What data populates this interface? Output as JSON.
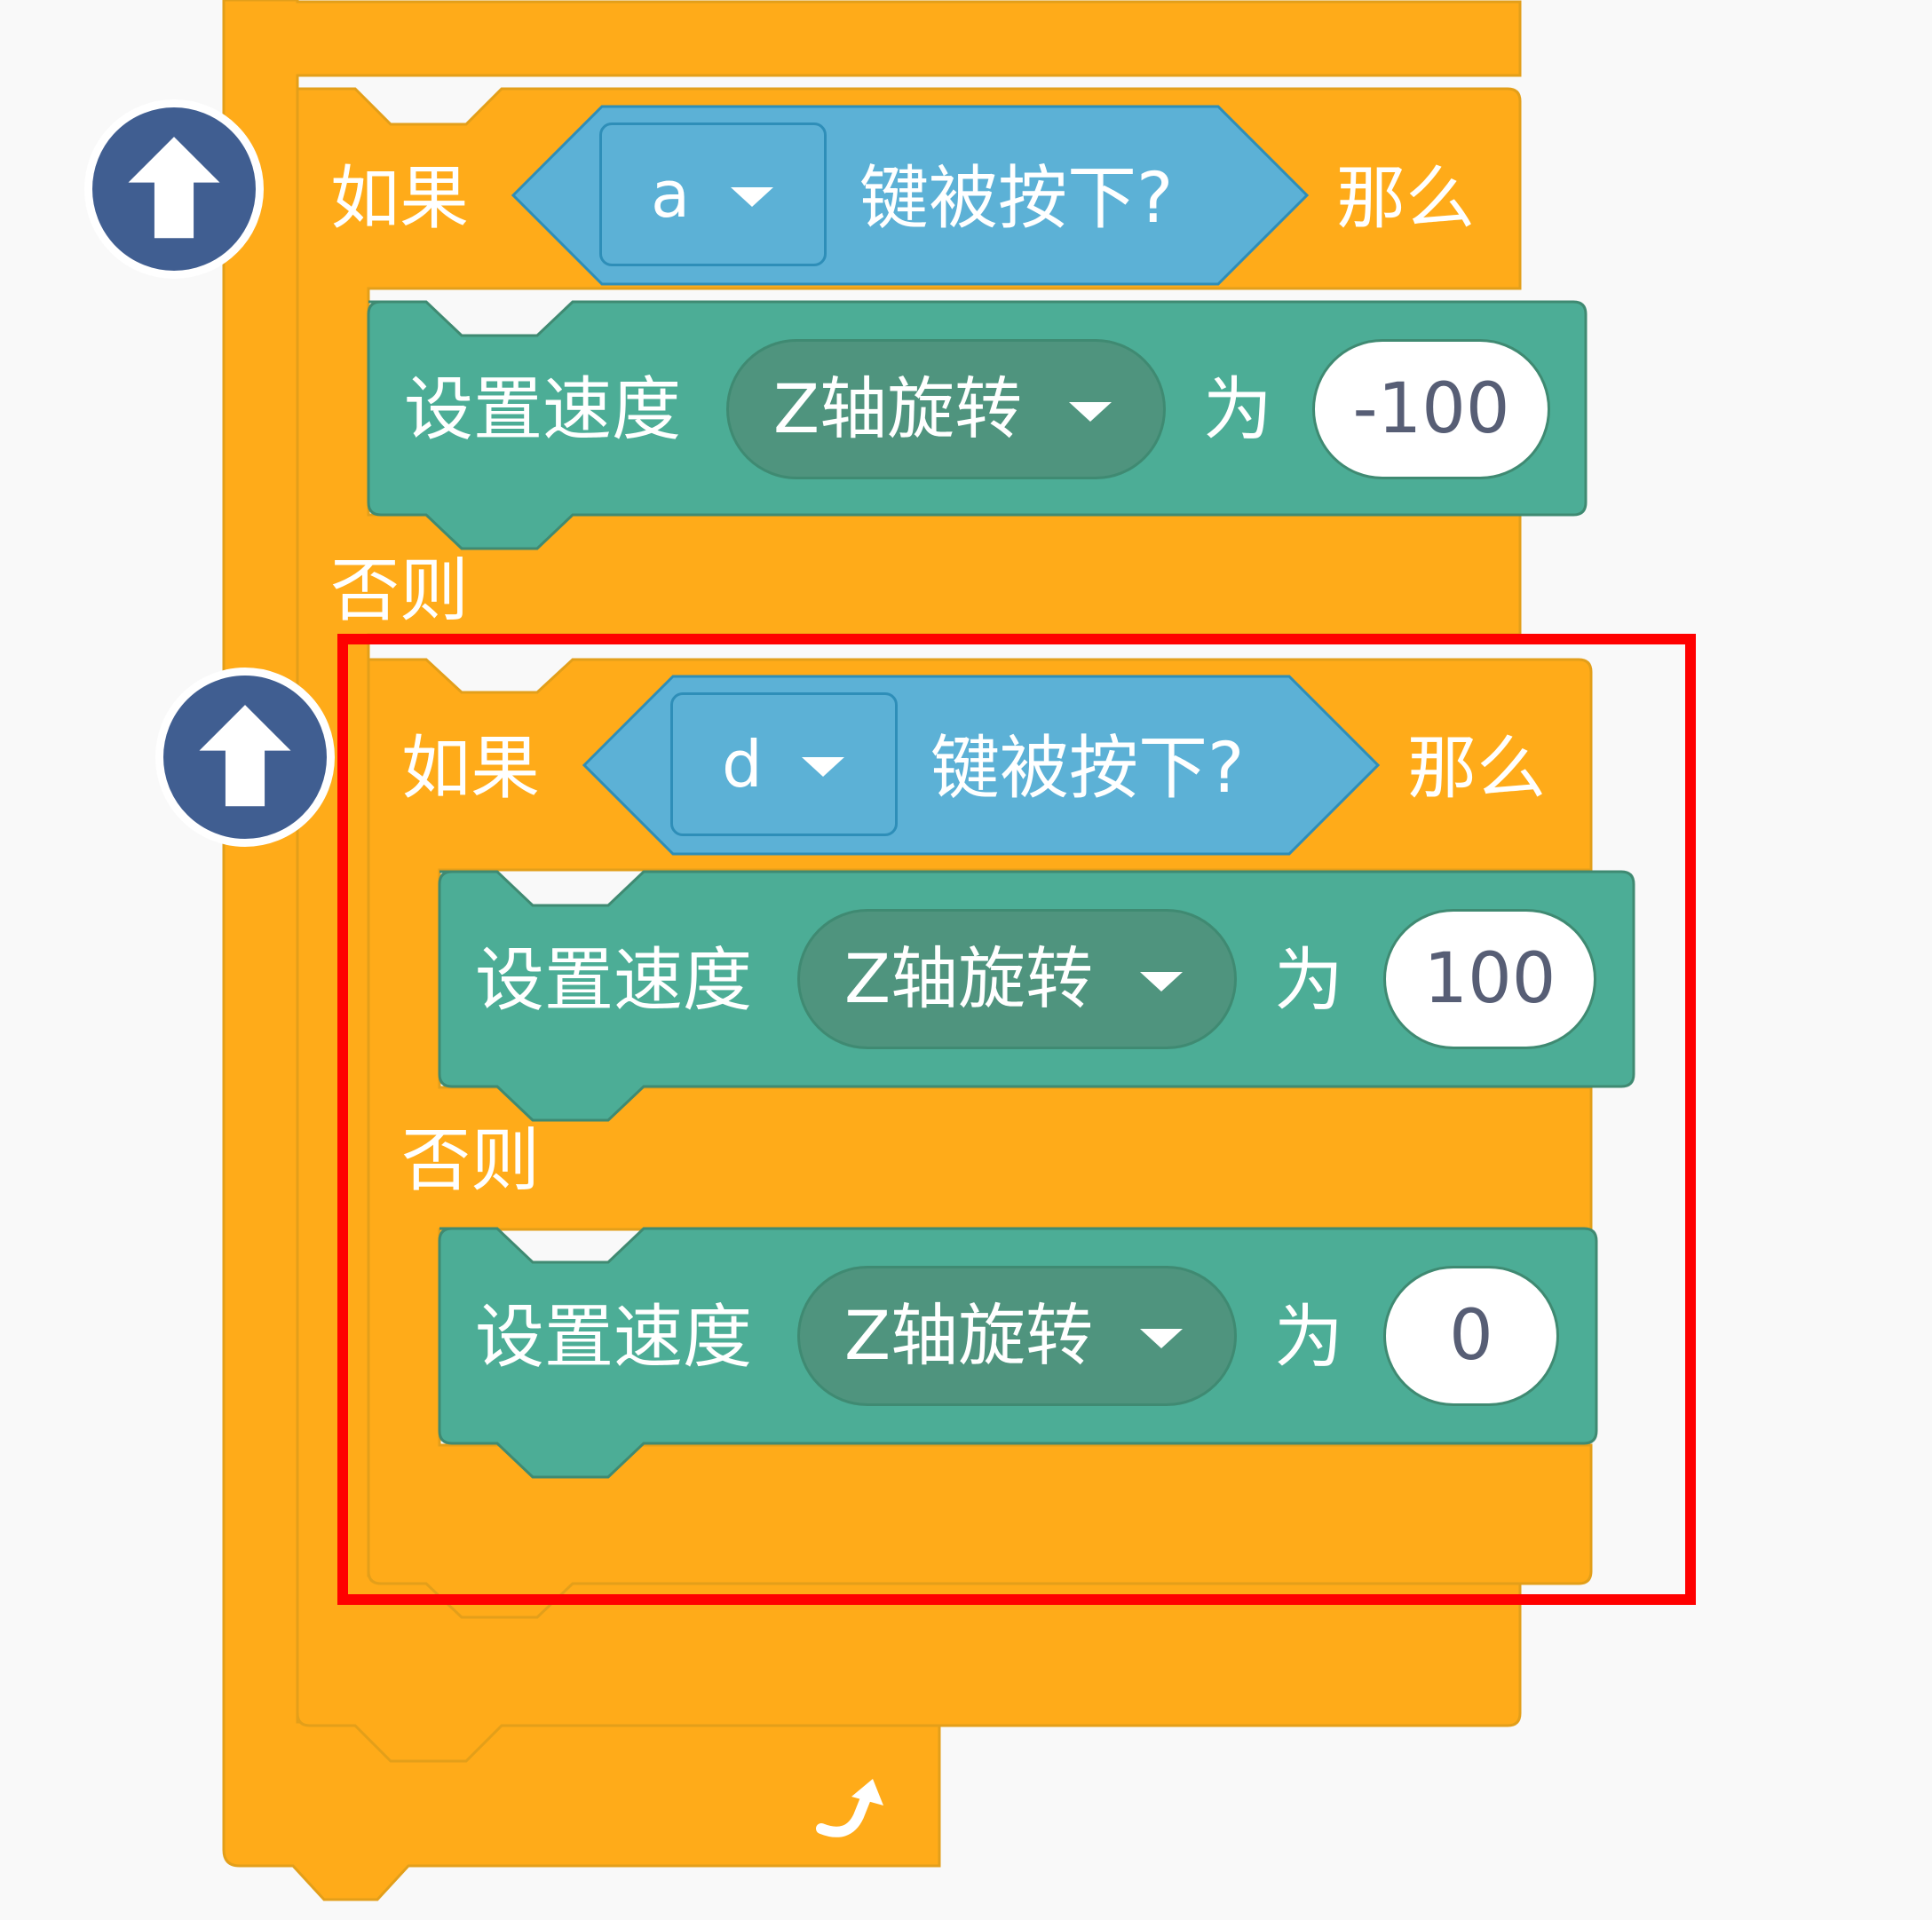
{
  "colors": {
    "control": "#ffab19",
    "control_dark": "#e39f1a",
    "sensing": "#5cb1d6",
    "sensing_dark": "#2e8eb8",
    "motion_green": "#4cad96",
    "motion_green_dark": "#3f8a72",
    "menu_pill": "#4f947e",
    "collapse_button": "#405e91",
    "highlight": "#ff0000"
  },
  "outer_if": {
    "if_label": "如果",
    "then_label": "那么",
    "else_label": "否则",
    "condition": {
      "key": "a",
      "label": "键被按下?"
    },
    "then_block": {
      "label": "设置速度",
      "menu": "Z轴旋转",
      "to_label": "为",
      "value": "-100"
    }
  },
  "inner_if": {
    "if_label": "如果",
    "then_label": "那么",
    "else_label": "否则",
    "condition": {
      "key": "d",
      "label": "键被按下?"
    },
    "then_block": {
      "label": "设置速度",
      "menu": "Z轴旋转",
      "to_label": "为",
      "value": "100"
    },
    "else_block": {
      "label": "设置速度",
      "menu": "Z轴旋转",
      "to_label": "为",
      "value": "0"
    }
  },
  "icons": {
    "collapse_1": "arrow-up-icon",
    "collapse_2": "arrow-up-icon",
    "loop": "loop-arrow-icon",
    "dropdown": "caret-down-icon"
  }
}
